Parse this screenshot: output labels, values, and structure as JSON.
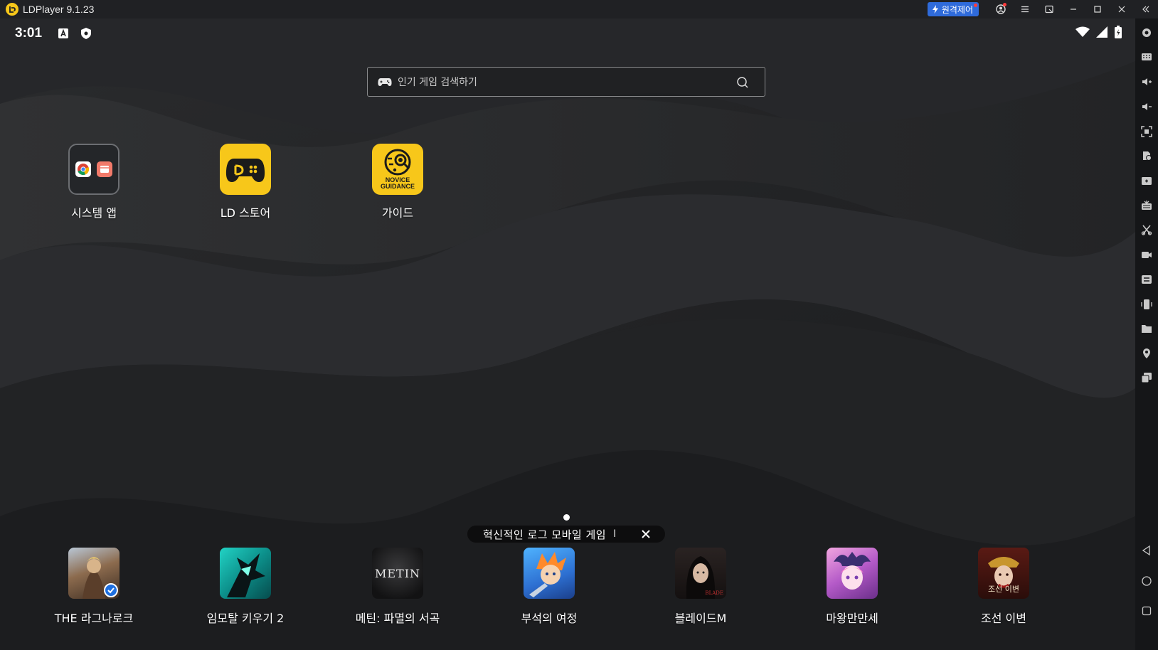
{
  "window": {
    "title": "LDPlayer 9.1.23",
    "remote_label": "원격제어"
  },
  "status": {
    "time": "3:01"
  },
  "search": {
    "placeholder": "인기 게임 검색하기"
  },
  "desktop": {
    "apps": [
      {
        "label": "시스템 앱",
        "icon": "folder-icon"
      },
      {
        "label": "LD 스토어",
        "icon": "gamepad-icon"
      },
      {
        "label": "가이드",
        "icon": "novice-guidance-icon",
        "icon_text": "NOVICE GUIDANCE"
      }
    ]
  },
  "banner": {
    "text": "혁신적인 로그 모바일 게임",
    "separator": "I"
  },
  "dock": {
    "apps": [
      {
        "label": "THE 라그나로크"
      },
      {
        "label": "임모탈 키우기 2"
      },
      {
        "label": "메틴: 파멸의 서곡",
        "icon_text": "METIN"
      },
      {
        "label": "부석의 여정"
      },
      {
        "label": "블레이드M",
        "icon_text": "BLADE"
      },
      {
        "label": "마왕만만세"
      },
      {
        "label": "조선 이변",
        "icon_text": "조선 이변"
      }
    ]
  },
  "colors": {
    "accent": "#f7c71a",
    "remote": "#2f6bdb",
    "background": "#1f2022"
  }
}
